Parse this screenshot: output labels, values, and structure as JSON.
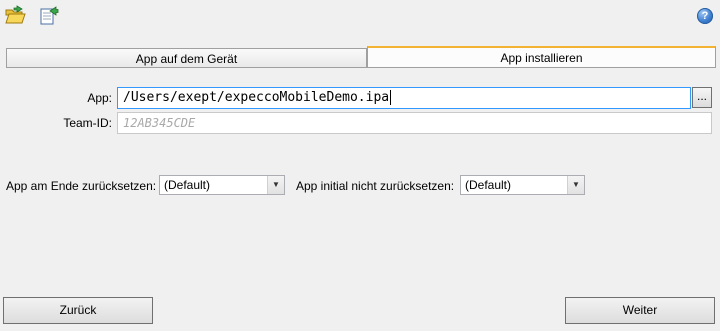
{
  "toolbar": {
    "open_icon": "folder-open-icon",
    "export_icon": "document-export-icon",
    "help_icon": "help-icon",
    "help_glyph": "?"
  },
  "tabs": [
    {
      "label": "App auf dem Gerät",
      "active": false
    },
    {
      "label": "App installieren",
      "active": true
    }
  ],
  "form": {
    "app_label": "App:",
    "app_value": "/Users/exept/expeccoMobileDemo.ipa",
    "browse_label": "...",
    "team_label": "Team-ID:",
    "team_placeholder": "12AB345CDE",
    "reset_end_label": "App am Ende zurücksetzen:",
    "reset_end_value": "(Default)",
    "no_reset_label": "App initial nicht zurücksetzen:",
    "no_reset_value": "(Default)"
  },
  "footer": {
    "back_label": "Zurück",
    "next_label": "Weiter"
  },
  "colors": {
    "active_tab_accent": "#f2b233",
    "window_bg": "#f0f0f0"
  }
}
